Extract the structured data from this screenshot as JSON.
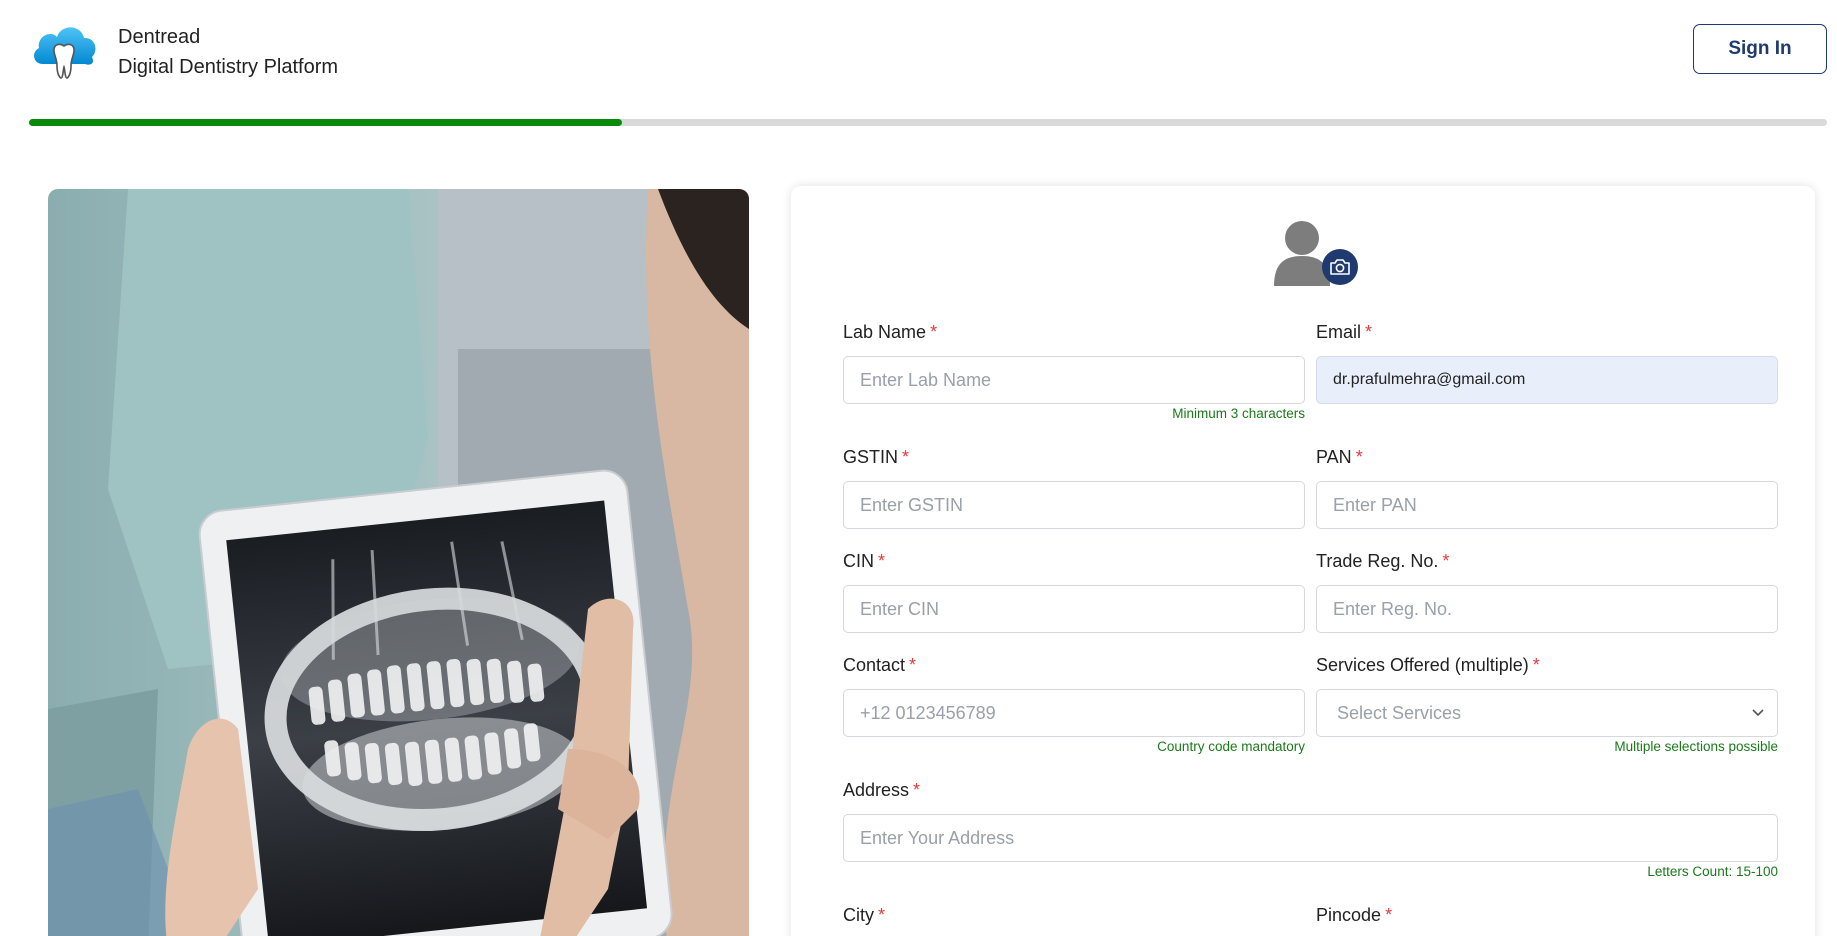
{
  "header": {
    "brand_name": "Dentread",
    "brand_tagline": "Digital Dentistry Platform",
    "signin_label": "Sign In"
  },
  "progress": {
    "percent": 33
  },
  "form": {
    "lab_name": {
      "label": "Lab Name",
      "required": "*",
      "placeholder": "Enter Lab Name",
      "hint": "Minimum 3 characters"
    },
    "email": {
      "label": "Email",
      "required": "*",
      "value": "dr.prafulmehra@gmail.com"
    },
    "gstin": {
      "label": "GSTIN",
      "required": "*",
      "placeholder": "Enter GSTIN"
    },
    "pan": {
      "label": "PAN",
      "required": "*",
      "placeholder": "Enter PAN"
    },
    "cin": {
      "label": "CIN",
      "required": "*",
      "placeholder": "Enter CIN"
    },
    "trade_reg": {
      "label": "Trade Reg. No.",
      "required": "*",
      "placeholder": "Enter Reg. No."
    },
    "contact": {
      "label": "Contact",
      "required": "*",
      "placeholder": "+12 0123456789",
      "hint": "Country code mandatory"
    },
    "services": {
      "label": "Services Offered (multiple)",
      "required": "*",
      "selected": "Select Services",
      "hint": "Multiple selections possible"
    },
    "address": {
      "label": "Address",
      "required": "*",
      "placeholder": "Enter Your Address",
      "hint": "Letters Count: 15-100"
    },
    "city": {
      "label": "City",
      "required": "*"
    },
    "pincode": {
      "label": "Pincode",
      "required": "*"
    }
  },
  "icons": {
    "logo": "cloud-tooth-logo",
    "avatar": "user-silhouette-icon",
    "camera": "camera-icon",
    "select_caret": "chevron-down-icon"
  },
  "colors": {
    "brand_navy": "#1e3a6e",
    "progress_green": "#0a8a0a",
    "required_red": "#e23b3b",
    "hint_green": "#1a7a1a",
    "logo_blue": "#29b6f6"
  }
}
